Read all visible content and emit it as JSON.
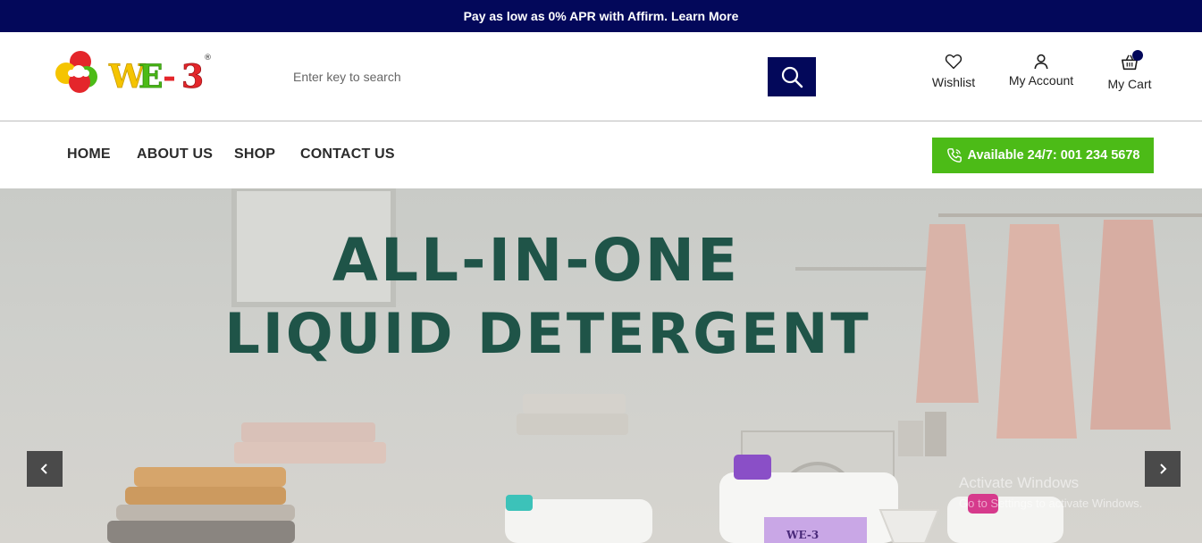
{
  "promo": {
    "text": "Pay as low as 0% APR with Affirm. Learn More"
  },
  "header": {
    "logo_text": "WE-3",
    "logo_reg": "®",
    "search": {
      "placeholder": "Enter key to search",
      "value": ""
    },
    "wishlist_label": "Wishlist",
    "account_label": "My Account",
    "cart_label": "My Cart"
  },
  "nav": {
    "items": [
      {
        "label": "HOME"
      },
      {
        "label": "ABOUT US"
      },
      {
        "label": "SHOP"
      },
      {
        "label": "CONTACT US"
      }
    ],
    "phone_label": "Available 24/7: 001 234 5678"
  },
  "hero": {
    "title_line1": "ALL-IN-ONE",
    "title_line2": "LIQUID DETERGENT",
    "bottle_label": "WE-3"
  },
  "os_watermark": {
    "line1": "Activate Windows",
    "line2": "Go to Settings to activate Windows."
  },
  "colors": {
    "brand_navy": "#03085a",
    "accent_green": "#4cbb17",
    "hero_text": "#1f5448"
  },
  "icons": [
    "search-icon",
    "heart-icon",
    "user-icon",
    "basket-icon",
    "phone-icon",
    "chevron-left-icon",
    "chevron-right-icon"
  ]
}
